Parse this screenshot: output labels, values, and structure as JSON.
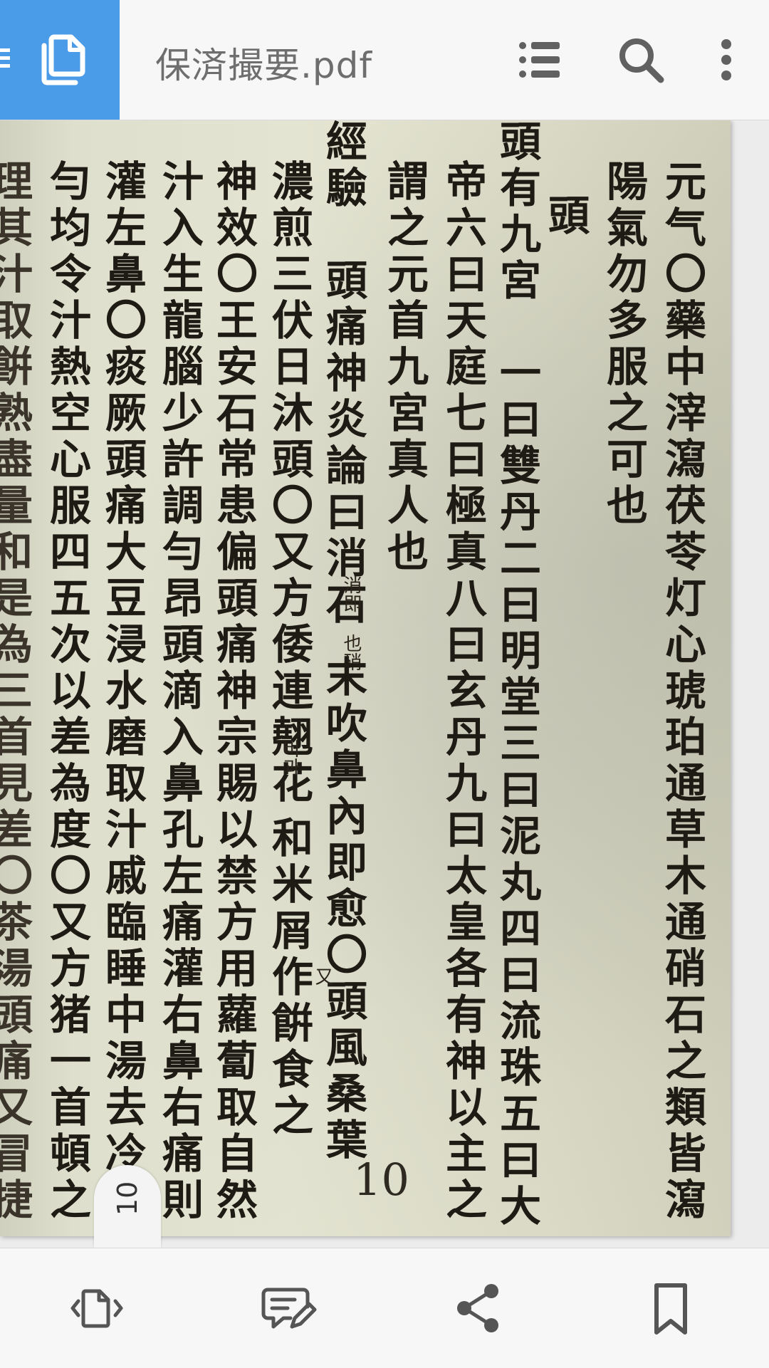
{
  "app_bar": {
    "title": "保済撮要.pdf",
    "accent_color": "#4a9be8",
    "icons": [
      "menu-icon",
      "copy-document-icon",
      "list-icon",
      "search-icon",
      "more-vert-icon"
    ]
  },
  "document": {
    "columns": [
      "元气〇藥中滓瀉茯苓灯心琥珀通草木通硝石之類皆瀉",
      "陽氣勿多服之可也",
      "頭",
      "頭有九宮　一曰雙丹二曰明堂三曰泥丸四曰流珠五曰大",
      "帝六曰天庭七曰極真八曰玄丹九曰太皇各有神以主之",
      "謂之元首九宮真人也",
      "經驗　頭痛神炎論曰消石",
      "末吹鼻內即愈〇頭風桑葉",
      "濃煎三伏日沐頭〇又方倭連翹花",
      "和米屑作餠食之",
      "神效〇王安石常患偏頭痛神宗賜以禁方用蘿蔔取自然",
      "汁入生龍腦少許調勻昂頭滴入鼻孔左痛灌右鼻右痛則",
      "灌左鼻〇痰厥頭痛大豆浸水磨取汁戚臨睡中湯去冷氣",
      "勻均令汁熱空心服四五次以差為度〇又方猪一首頓之",
      "理其汁取餠熟盡量和是為三首見差〇茶湯頭痛又冒捷"
    ],
    "notes": [
      "消即 也硝",
      "비과",
      "又"
    ],
    "page_number": "10"
  },
  "page_indicator": "10",
  "bottom_bar": {
    "icons": [
      "page-navigate-icon",
      "comment-edit-icon",
      "share-icon",
      "bookmark-icon"
    ]
  }
}
